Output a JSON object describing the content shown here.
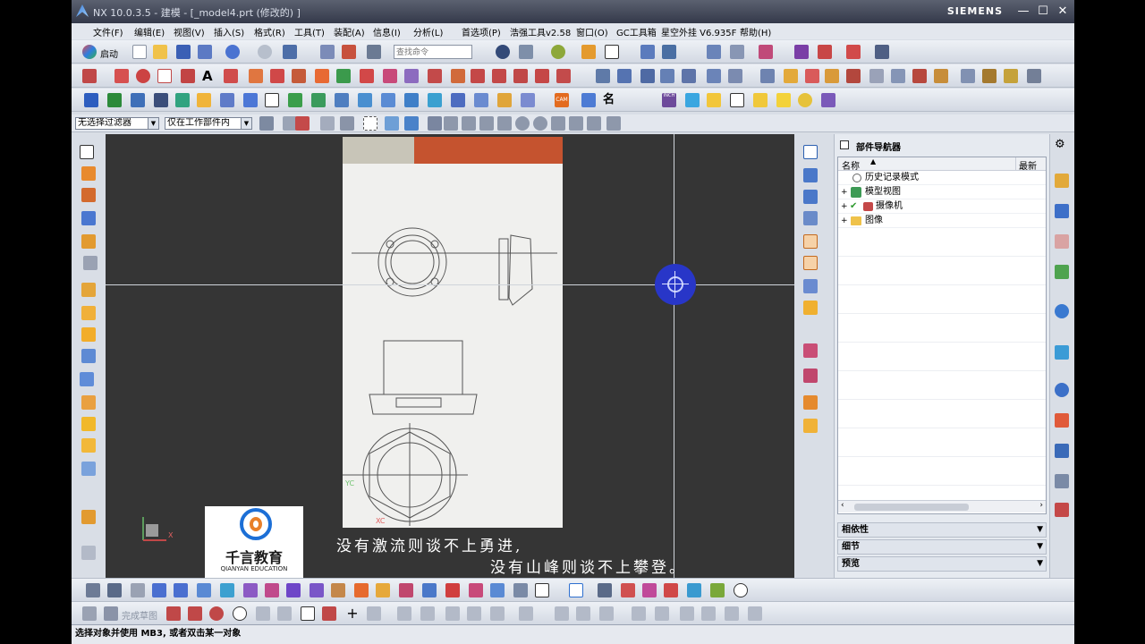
{
  "window": {
    "title": "NX 10.0.3.5 - 建模 - [_model4.prt  (修改的) ]",
    "brand": "SIEMENS",
    "btn_min": "—",
    "btn_max": "☐",
    "btn_close": "✕"
  },
  "menu": [
    "文件(F)",
    "编辑(E)",
    "视图(V)",
    "插入(S)",
    "格式(R)",
    "工具(T)",
    "装配(A)",
    "信息(I)",
    "分析(L)",
    "首选项(P)",
    "浩强工具v2.58",
    "窗口(O)",
    "GC工具箱",
    "星空外挂 V6.935F",
    "帮助(H)"
  ],
  "toolbar1": {
    "start_label": "启动",
    "search_placeholder": "查找命令"
  },
  "filterbar": {
    "type_filter": "无选择过滤器",
    "scope": "仅在工作部件内"
  },
  "part_navigator": {
    "title": "部件导航器",
    "col_name": "名称",
    "col_latest": "最新",
    "items": [
      "历史记录模式",
      "模型视图",
      "摄像机",
      "图像"
    ]
  },
  "panels": [
    "相依性",
    "细节",
    "预览"
  ],
  "viewport": {
    "logo_cn": "千言教育",
    "logo_en": "QIANYAN EDUCATION",
    "subtitle_line1": "没有激流则谈不上勇进,",
    "subtitle_line2": "没有山峰则谈不上攀登。",
    "axis_x": "X",
    "axis_y": "YC",
    "axis_xc": "XC"
  },
  "bottom_toolbar2": {
    "sketch_label": "完成草图"
  },
  "status": {
    "text": "选择对象并使用 MB3, 或者双击某一对象"
  },
  "colors": {
    "titlebar": "#3f4556",
    "viewport_bg": "#353535",
    "selection_dot": "#2836c8",
    "subtitle": "#ffffff"
  }
}
